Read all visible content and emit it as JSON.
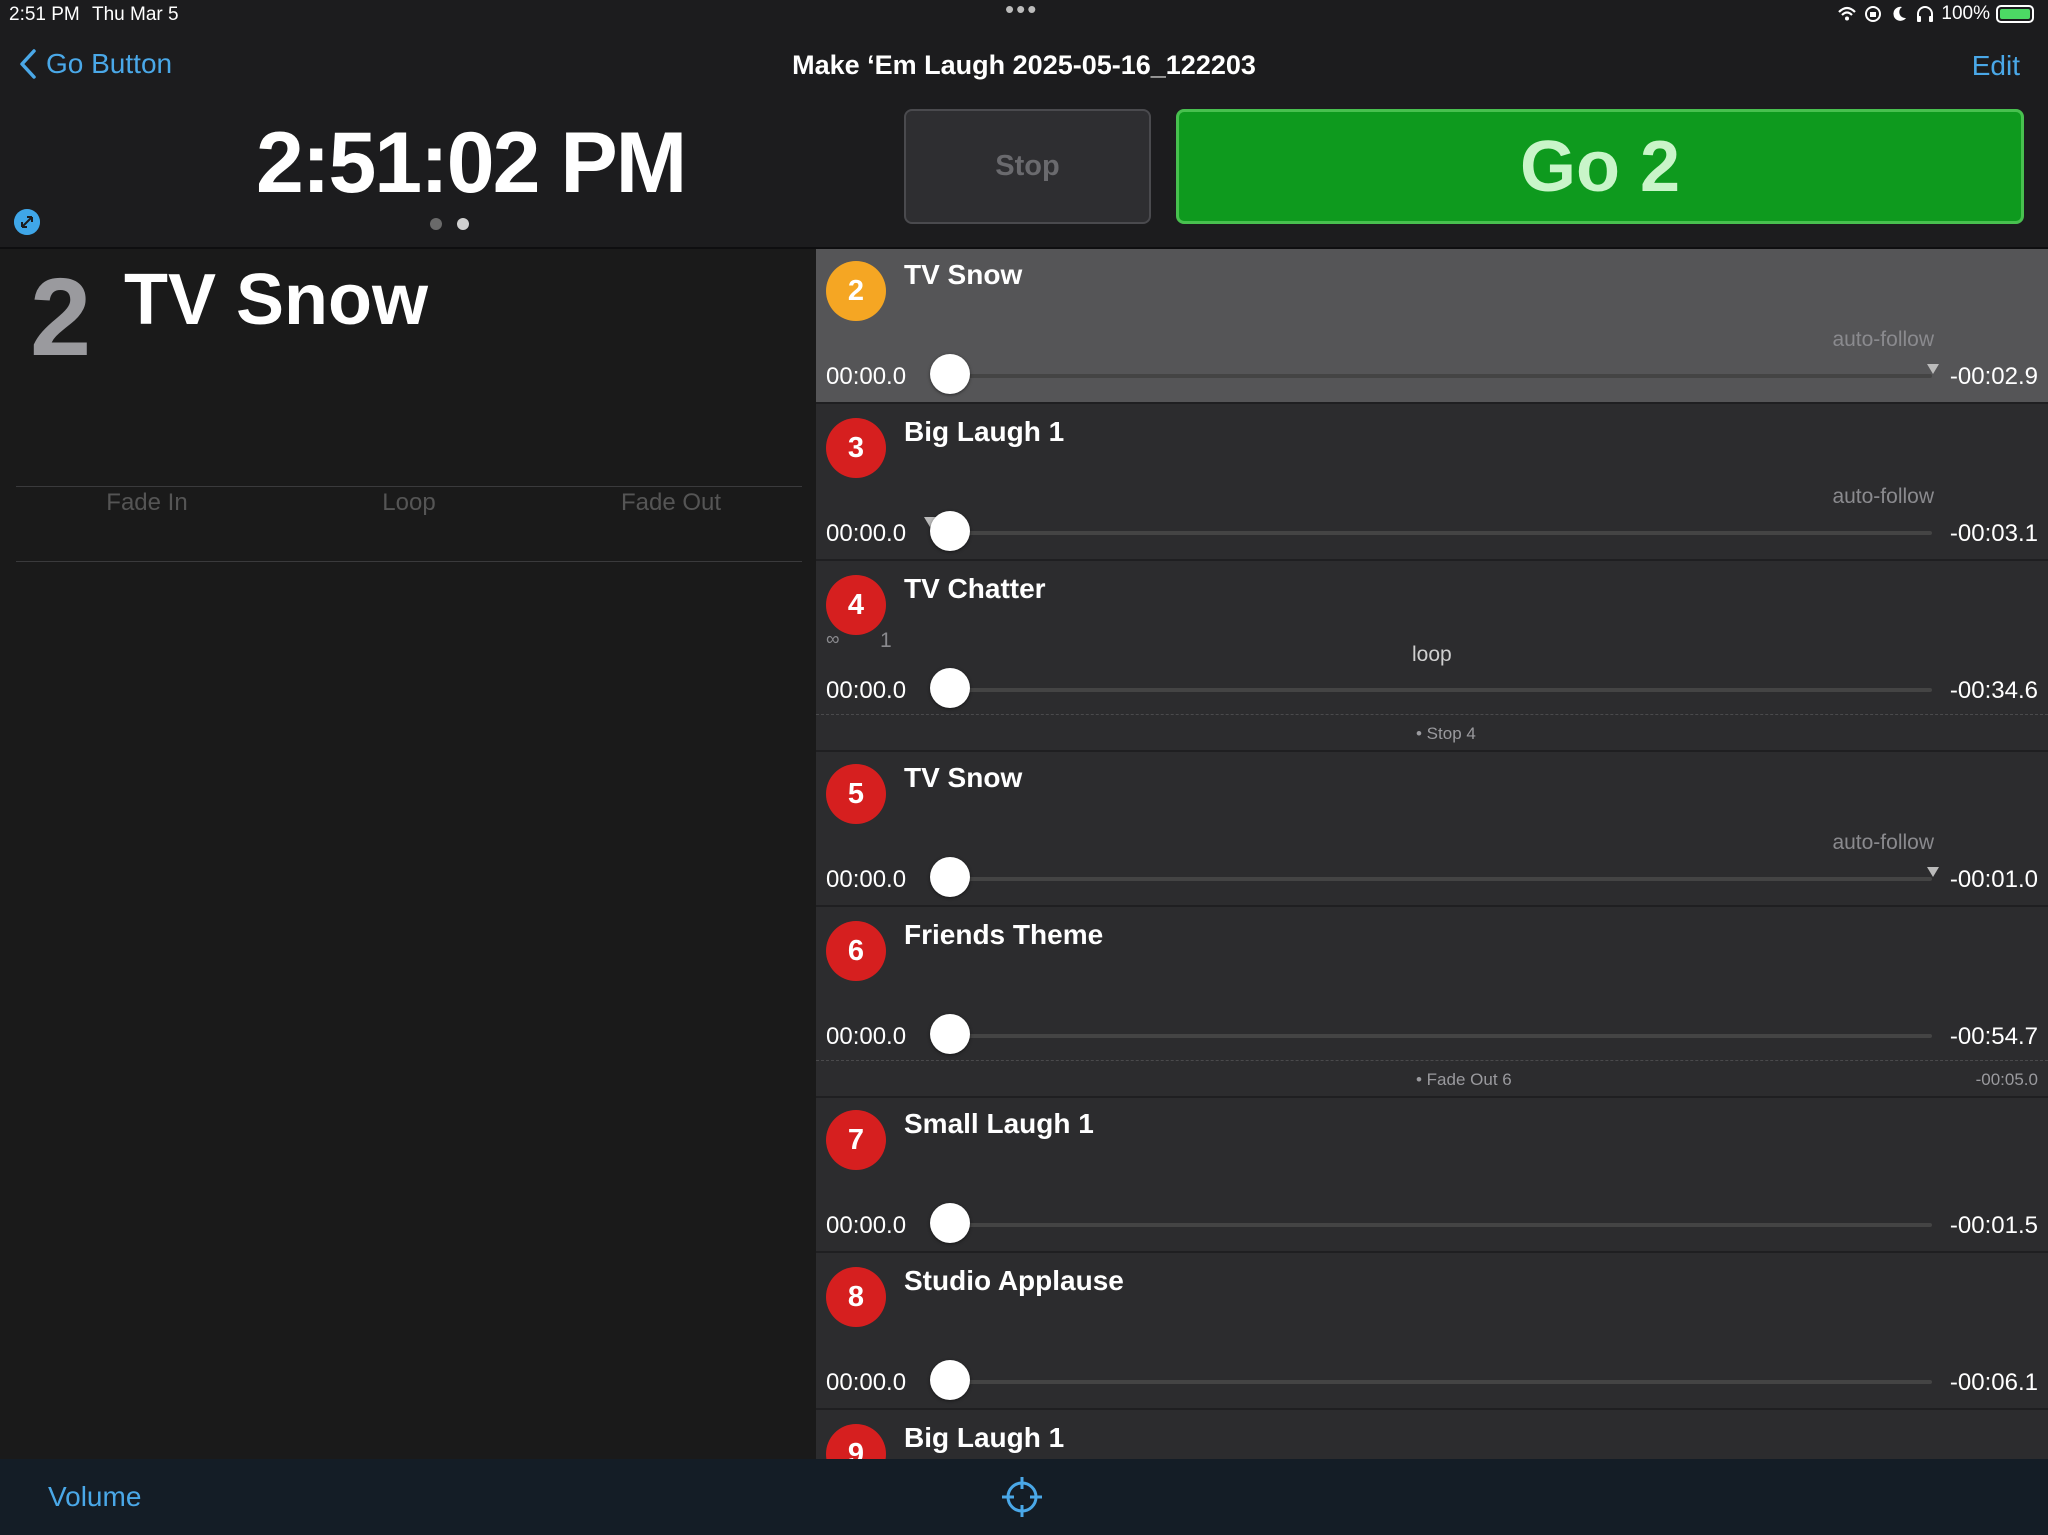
{
  "status_bar": {
    "time": "2:51 PM",
    "date": "Thu Mar 5",
    "battery": "100%"
  },
  "nav": {
    "back_label": "Go Button",
    "title": "Make ‘Em Laugh 2025-05-16_122203",
    "edit_label": "Edit"
  },
  "clock": "2:51:02 PM",
  "controls": {
    "stop_label": "Stop",
    "go_label": "Go 2",
    "go_color": "#0e9a1e"
  },
  "current_cue": {
    "number": "2",
    "name": "TV Snow",
    "fade_in_label": "Fade In",
    "loop_label": "Loop",
    "fade_out_label": "Fade Out"
  },
  "cues": [
    {
      "number": "2",
      "name": "TV Snow",
      "flag": "auto-follow",
      "elapsed": "00:00.0",
      "remaining": "-00:02.9",
      "state": "active"
    },
    {
      "number": "3",
      "name": "Big Laugh 1",
      "flag": "auto-follow",
      "elapsed": "00:00.0",
      "remaining": "-00:03.1"
    },
    {
      "number": "4",
      "name": "TV Chatter",
      "flag": "loop",
      "loop_symbol": "∞",
      "loop_count": "1",
      "elapsed": "00:00.0",
      "remaining": "-00:34.6"
    },
    {
      "number": "5",
      "name": "TV Snow",
      "flag": "auto-follow",
      "elapsed": "00:00.0",
      "remaining": "-00:01.0"
    },
    {
      "number": "6",
      "name": "Friends Theme",
      "flag": "",
      "elapsed": "00:00.0",
      "remaining": "-00:54.7"
    },
    {
      "number": "7",
      "name": "Small Laugh 1",
      "flag": "",
      "elapsed": "00:00.0",
      "remaining": "-00:01.5"
    },
    {
      "number": "8",
      "name": "Studio Applause",
      "flag": "",
      "elapsed": "00:00.0",
      "remaining": "-00:06.1"
    },
    {
      "number": "9",
      "name": "Big Laugh 1"
    }
  ],
  "sub_cues": [
    {
      "label": "• Stop 4",
      "time": ""
    },
    {
      "label": "• Fade Out 6",
      "time": "-00:05.0"
    }
  ],
  "bottom_bar": {
    "volume_label": "Volume"
  },
  "colors": {
    "accent": "#4aa8e8",
    "active_badge": "#f5a623",
    "cue_badge": "#d61f1f"
  }
}
